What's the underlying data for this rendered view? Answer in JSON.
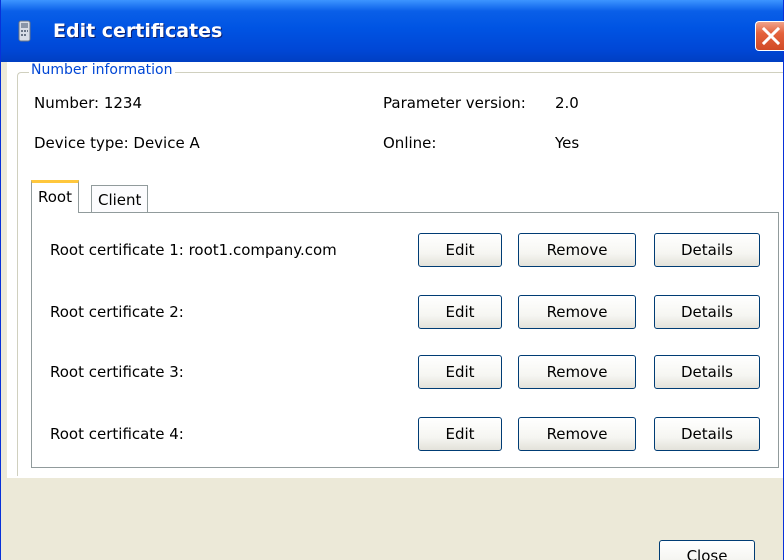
{
  "window": {
    "title": "Edit certificates"
  },
  "number_info": {
    "legend": "Number information",
    "number_label": "Number: 1234",
    "device_type_label": "Device type: Device A",
    "param_version_label": "Parameter version:",
    "param_version_value": "2.0",
    "online_label": "Online:",
    "online_value": "Yes"
  },
  "tabs": [
    {
      "label": "Root",
      "active": true
    },
    {
      "label": "Client",
      "active": false
    }
  ],
  "certificates": [
    {
      "label": "Root certificate 1: root1.company.com"
    },
    {
      "label": "Root certificate 2:"
    },
    {
      "label": "Root certificate 3:"
    },
    {
      "label": "Root certificate 4:"
    }
  ],
  "buttons": {
    "edit": "Edit",
    "remove": "Remove",
    "details": "Details",
    "close": "Close"
  },
  "colors": {
    "titlebar": "#0054e3",
    "legend": "#0046d5",
    "tab_active_accent": "#ffc73c",
    "close_x": "#e4623c"
  },
  "icons": {
    "title_icon": "device-icon",
    "close_icon": "close-icon"
  }
}
